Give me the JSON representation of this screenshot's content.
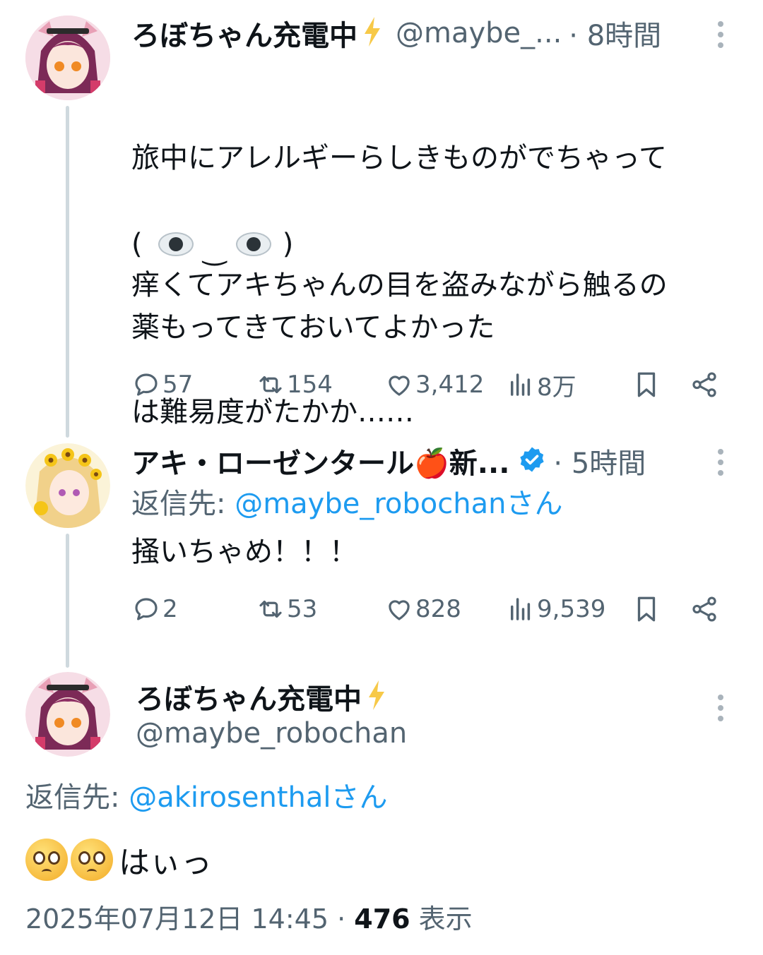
{
  "tweet1": {
    "display_name": "ろぼちゃん充電中",
    "handle": "@maybe_...",
    "time": "· 8時間",
    "lines": [
      "旅中にアレルギーらしきものがでちゃって",
      "痒くてアキちゃんの目を盗みながら触るの",
      "は難易度がたかか……"
    ],
    "kaomoji_left": "(",
    "kaomoji_mid": "‿",
    "kaomoji_right": ")",
    "last_line": "薬もってきておいてよかった",
    "replies": "57",
    "retweets": "154",
    "likes": "3,412",
    "views": "8万"
  },
  "tweet2": {
    "display_name": "アキ・ローゼンタール🍎新...",
    "time": "· 5時間",
    "reply_prefix": "返信先: ",
    "reply_handle": "@maybe_robochanさん",
    "text": "掻いちゃめ！！！",
    "replies": "2",
    "retweets": "53",
    "likes": "828",
    "views": "9,539"
  },
  "main": {
    "display_name": "ろぼちゃん充電中",
    "handle": "@maybe_robochan",
    "reply_prefix": "返信先: ",
    "reply_handle": "@akirosenthalさん",
    "text": "はぃっ",
    "timestamp": "2025年07月12日 14:45 · ",
    "view_count": "476",
    "view_label": " 表示"
  },
  "colors": {
    "accent": "#1d9bf0",
    "muted": "#536471",
    "bolt": "#f7c948",
    "thread": "#cfd9de"
  },
  "icons": [
    "lightning-icon",
    "verified-badge-icon",
    "reply-icon",
    "retweet-icon",
    "like-icon",
    "views-icon",
    "bookmark-icon",
    "share-icon",
    "more-icon"
  ]
}
